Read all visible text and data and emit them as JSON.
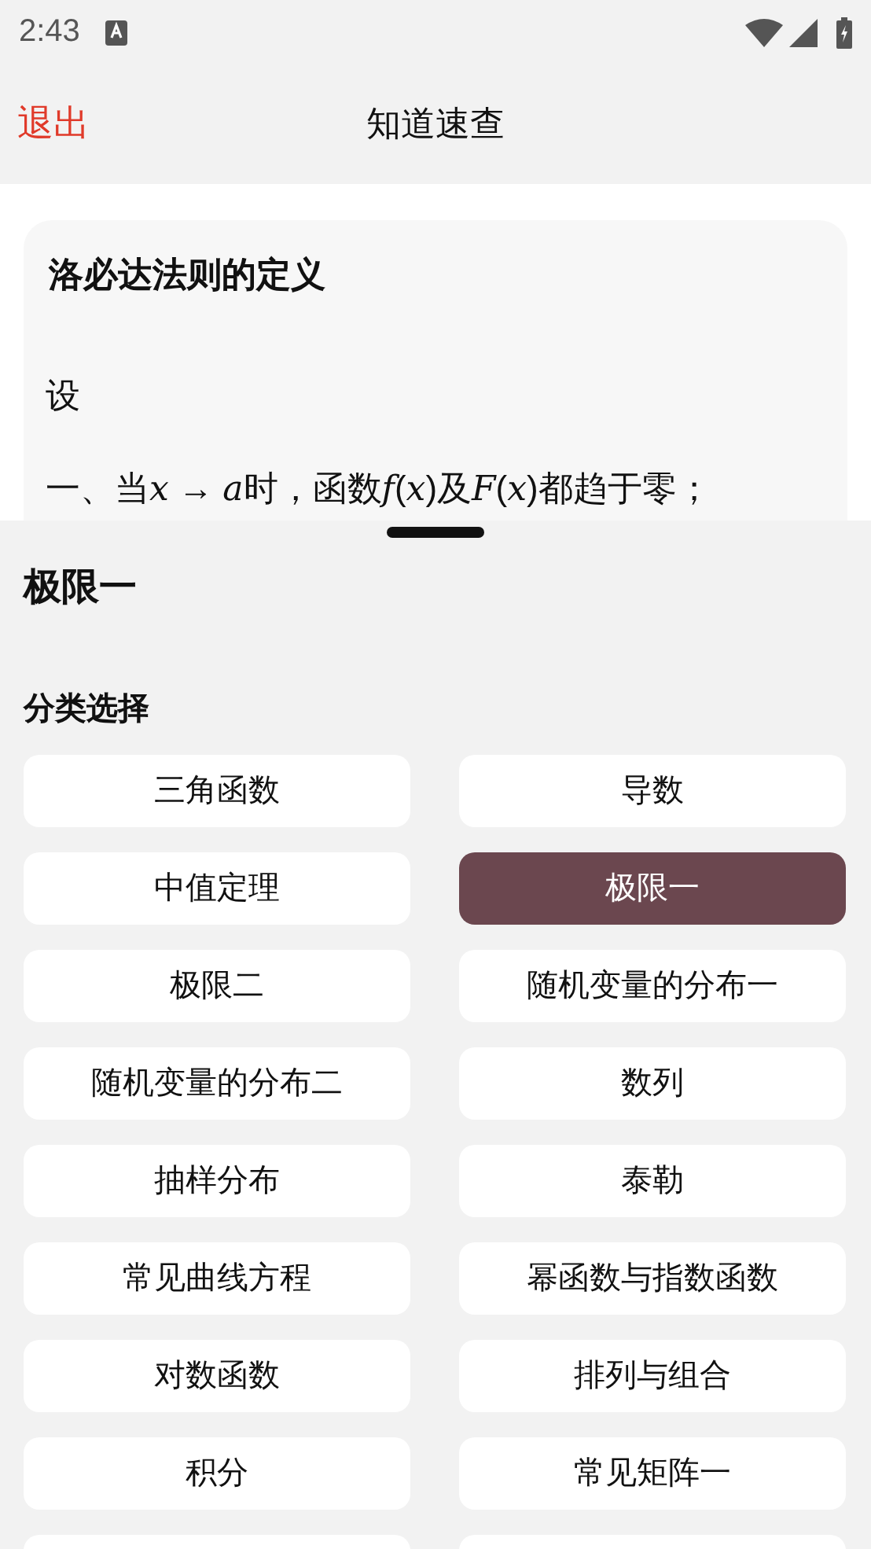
{
  "status_bar": {
    "time": "2:43"
  },
  "header": {
    "back": "退出",
    "title": "知道速查"
  },
  "card": {
    "title": "洛必达法则的定义",
    "paragraphs": [
      [
        {
          "text": "设",
          "italic": false
        }
      ],
      [
        {
          "text": "一、当",
          "italic": false
        },
        {
          "text": "x",
          "italic": true
        },
        {
          "text": " → ",
          "italic": false
        },
        {
          "text": "a",
          "italic": true
        },
        {
          "text": "时，函数",
          "italic": false
        },
        {
          "text": "f",
          "italic": true
        },
        {
          "text": "(",
          "italic": false
        },
        {
          "text": "x",
          "italic": true
        },
        {
          "text": ")及",
          "italic": false
        },
        {
          "text": "F",
          "italic": true
        },
        {
          "text": "(",
          "italic": false
        },
        {
          "text": "x",
          "italic": true
        },
        {
          "text": ")都趋于零；",
          "italic": false
        }
      ]
    ]
  },
  "sheet": {
    "title": "极限一",
    "section": "分类选择",
    "categories": [
      {
        "kind": "label",
        "label": "三角函数",
        "selected": false
      },
      {
        "kind": "label",
        "label": "导数",
        "selected": false
      },
      {
        "kind": "label",
        "label": "中值定理",
        "selected": false
      },
      {
        "kind": "label",
        "label": "极限一",
        "selected": true
      },
      {
        "kind": "label",
        "label": "极限二",
        "selected": false
      },
      {
        "kind": "label",
        "label": "随机变量的分布一",
        "selected": false
      },
      {
        "kind": "label",
        "label": "随机变量的分布二",
        "selected": false
      },
      {
        "kind": "label",
        "label": "数列",
        "selected": false
      },
      {
        "kind": "label",
        "label": "抽样分布",
        "selected": false
      },
      {
        "kind": "label",
        "label": "泰勒",
        "selected": false
      },
      {
        "kind": "label",
        "label": "常见曲线方程",
        "selected": false
      },
      {
        "kind": "label",
        "label": "幂函数与指数函数",
        "selected": false
      },
      {
        "kind": "label",
        "label": "对数函数",
        "selected": false
      },
      {
        "kind": "label",
        "label": "排列与组合",
        "selected": false
      },
      {
        "kind": "label",
        "label": "积分",
        "selected": false
      },
      {
        "kind": "label",
        "label": "常见矩阵一",
        "selected": false
      },
      {
        "kind": "cut-off",
        "selected": false
      },
      {
        "kind": "cut-off",
        "selected": false
      }
    ]
  }
}
